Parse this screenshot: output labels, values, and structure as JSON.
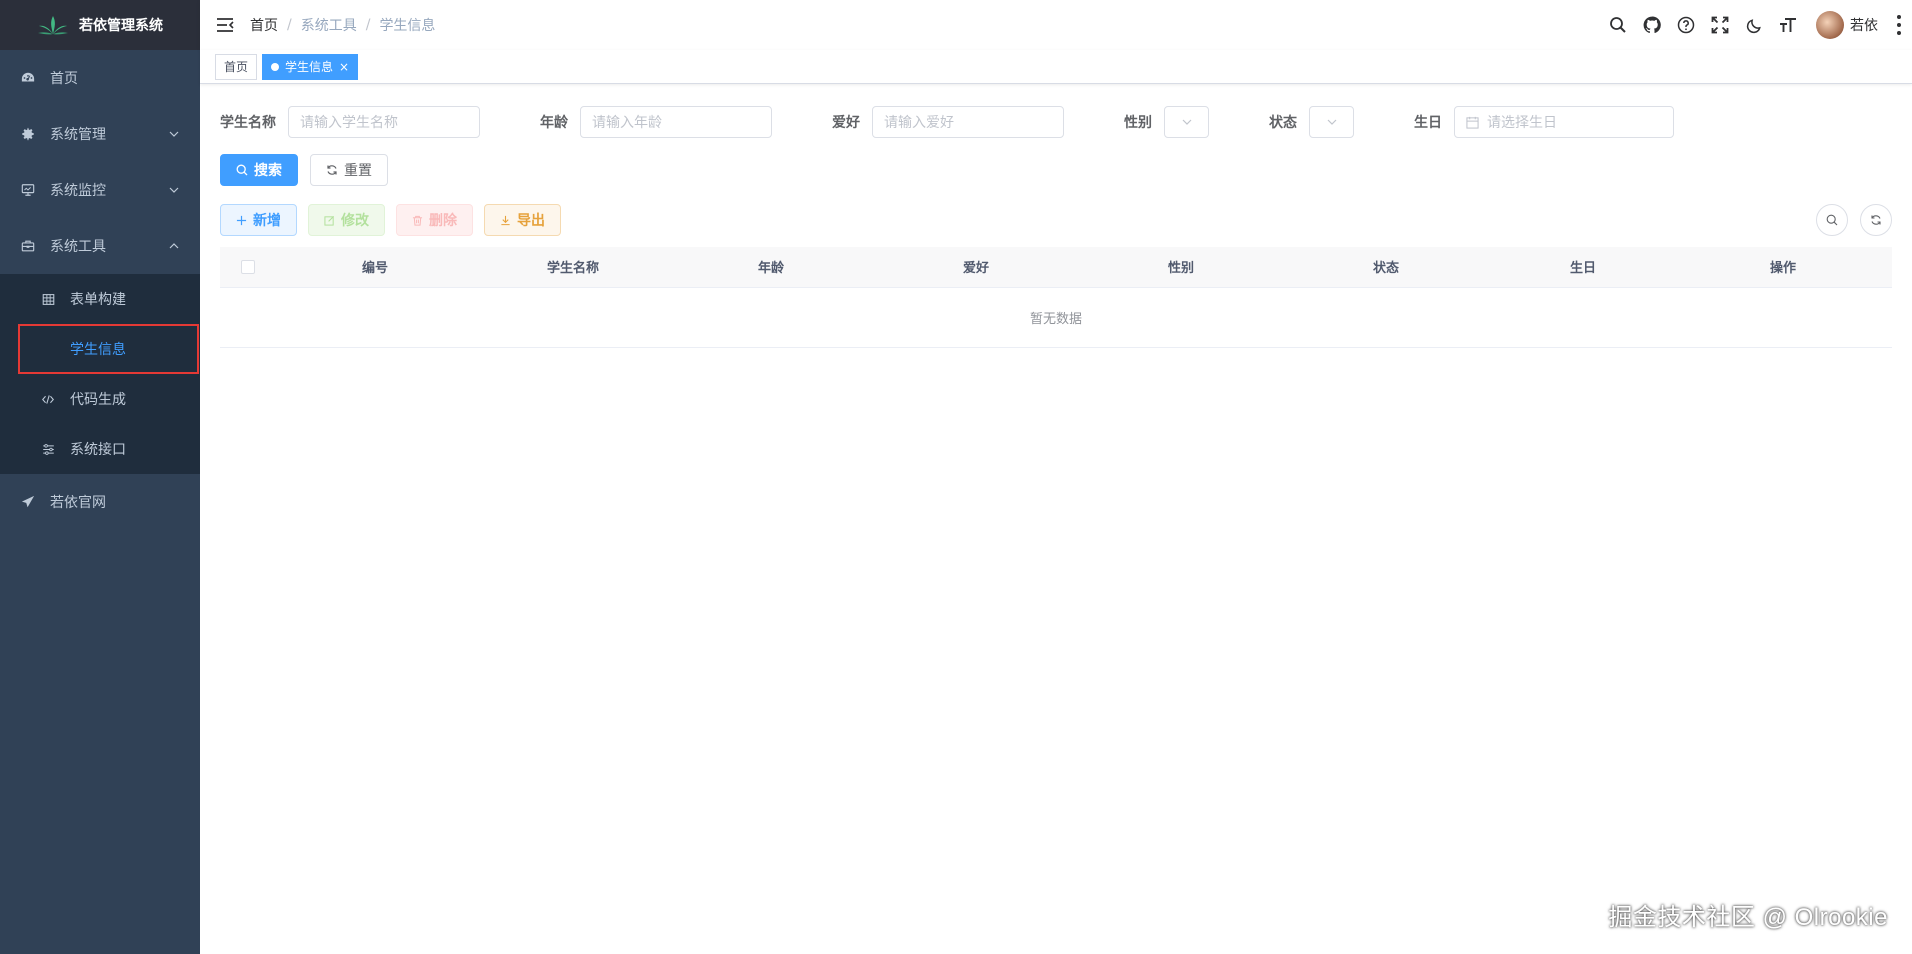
{
  "app": {
    "title": "若依管理系统"
  },
  "sidebar": {
    "items": [
      {
        "label": "首页",
        "icon": "dashboard-icon"
      },
      {
        "label": "系统管理",
        "icon": "gear-icon",
        "expanded": false
      },
      {
        "label": "系统监控",
        "icon": "monitor-icon",
        "expanded": false
      },
      {
        "label": "系统工具",
        "icon": "toolbox-icon",
        "expanded": true
      },
      {
        "label": "若依官网",
        "icon": "send-icon"
      }
    ],
    "tools_sub": [
      {
        "label": "表单构建",
        "icon": "table-icon"
      },
      {
        "label": "学生信息",
        "icon": "",
        "active": true
      },
      {
        "label": "代码生成",
        "icon": "code-icon"
      },
      {
        "label": "系统接口",
        "icon": "sliders-icon"
      }
    ]
  },
  "breadcrumb": [
    "首页",
    "系统工具",
    "学生信息"
  ],
  "breadcrumb_sep": "/",
  "user": {
    "name": "若依"
  },
  "tags": [
    {
      "label": "首页",
      "active": false
    },
    {
      "label": "学生信息",
      "active": true,
      "close": "×"
    }
  ],
  "search_form": {
    "name": {
      "label": "学生名称",
      "placeholder": "请输入学生名称"
    },
    "age": {
      "label": "年龄",
      "placeholder": "请输入年龄"
    },
    "hobby": {
      "label": "爱好",
      "placeholder": "请输入爱好"
    },
    "sex": {
      "label": "性别"
    },
    "status": {
      "label": "状态"
    },
    "birthday": {
      "label": "生日",
      "placeholder": "请选择生日"
    },
    "search_label": "搜索",
    "reset_label": "重置"
  },
  "toolbar": {
    "add_label": "新增",
    "edit_label": "修改",
    "delete_label": "删除",
    "export_label": "导出"
  },
  "table": {
    "columns": [
      "编号",
      "学生名称",
      "年龄",
      "爱好",
      "性别",
      "状态",
      "生日",
      "操作"
    ],
    "empty_text": "暂无数据"
  },
  "watermark": "掘金技术社区 @ Olrookie",
  "colors": {
    "primary": "#409eff",
    "sidebar_bg": "#304156",
    "highlight": "#e53935"
  }
}
